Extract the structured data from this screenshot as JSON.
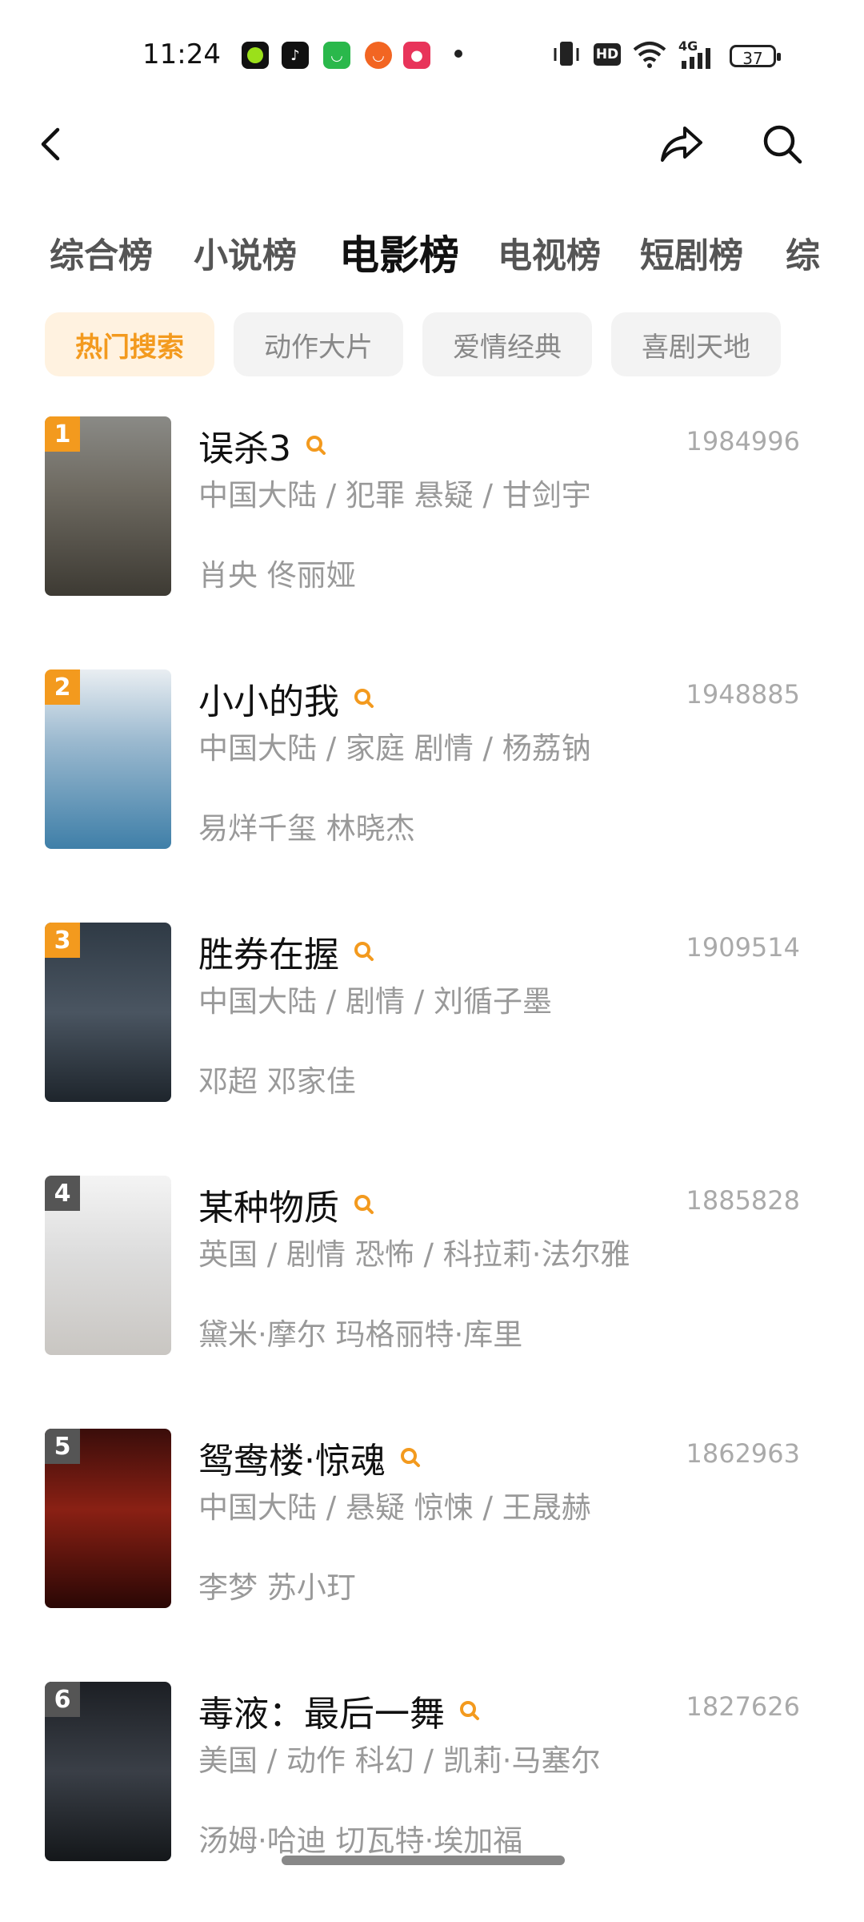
{
  "status_bar": {
    "time": "11:24",
    "battery": "37",
    "network": "4G",
    "hd_label": "HD",
    "app_icons": [
      "circle-app-icon",
      "tiktok-icon",
      "shopping-bag-icon",
      "orange-app-icon",
      "red-app-icon"
    ]
  },
  "header": {
    "back_icon": "chevron-left-icon",
    "share_icon": "share-arrow-icon",
    "search_icon": "search-icon"
  },
  "tabs": [
    {
      "label": "综合榜"
    },
    {
      "label": "小说榜"
    },
    {
      "label": "电影榜",
      "active": true
    },
    {
      "label": "电视榜"
    },
    {
      "label": "短剧榜"
    },
    {
      "label": "综"
    }
  ],
  "chips": [
    {
      "label": "热门搜索",
      "active": true
    },
    {
      "label": "动作大片"
    },
    {
      "label": "爱情经典"
    },
    {
      "label": "喜剧天地"
    }
  ],
  "colors": {
    "accent": "#f39a1e",
    "rank_top": "#f39a1e",
    "rank_other": "#555555"
  },
  "movies": [
    {
      "rank": "1",
      "title": "误杀3",
      "meta": "中国大陆 / 犯罪 悬疑 / 甘剑宇",
      "cast": "肖央 佟丽娅",
      "count": "1984996"
    },
    {
      "rank": "2",
      "title": "小小的我",
      "meta": "中国大陆 / 家庭 剧情 / 杨荔钠",
      "cast": "易烊千玺 林晓杰",
      "count": "1948885"
    },
    {
      "rank": "3",
      "title": "胜券在握",
      "meta": "中国大陆 / 剧情 / 刘循子墨",
      "cast": "邓超 邓家佳",
      "count": "1909514"
    },
    {
      "rank": "4",
      "title": "某种物质",
      "meta": "英国 / 剧情 恐怖 / 科拉莉·法尔雅",
      "cast": "黛米·摩尔 玛格丽特·库里",
      "count": "1885828"
    },
    {
      "rank": "5",
      "title": "鸳鸯楼·惊魂",
      "meta": "中国大陆 / 悬疑 惊悚 / 王晟赫",
      "cast": "李梦 苏小玎",
      "count": "1862963"
    },
    {
      "rank": "6",
      "title": "毒液：最后一舞",
      "meta": "美国 / 动作 科幻 / 凯莉·马塞尔",
      "cast": "汤姆·哈迪 切瓦特·埃加福",
      "count": "1827626"
    }
  ]
}
